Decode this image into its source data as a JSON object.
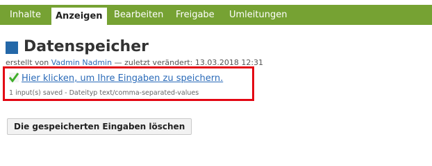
{
  "tabs": [
    {
      "label": "Inhalte",
      "active": false
    },
    {
      "label": "Anzeigen",
      "active": true
    },
    {
      "label": "Bearbeiten",
      "active": false
    },
    {
      "label": "Freigabe",
      "active": false
    },
    {
      "label": "Umleitungen",
      "active": false
    }
  ],
  "page": {
    "title": "Datenspeicher",
    "byline_prefix": "erstellt von",
    "author": "Vadmin Nadmin",
    "byline_suffix": "— zuletzt verändert: 13.03.2018 12:31"
  },
  "save": {
    "link_text": "Hier klicken, um Ihre Eingaben zu speichern.",
    "info": "1 input(s) saved - Dateityp text/comma-separated-values"
  },
  "actions": {
    "delete_label": "Die gespeicherten Eingaben löschen"
  },
  "colors": {
    "tabbar": "#76a233",
    "title_icon": "#2468a8",
    "link": "#2a6ab8",
    "highlight_border": "#e30613"
  }
}
